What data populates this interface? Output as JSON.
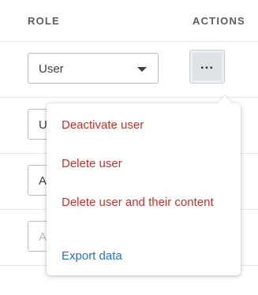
{
  "table": {
    "headers": {
      "role": "ROLE",
      "actions": "ACTIONS"
    },
    "rows": [
      {
        "role": "User",
        "actions_label": "..."
      },
      {
        "role": "U",
        "actions_label": ""
      },
      {
        "role": "A",
        "actions_label": ""
      },
      {
        "role": "A",
        "actions_label": ""
      }
    ]
  },
  "menu": {
    "items": [
      {
        "label": "Deactivate user",
        "kind": "danger"
      },
      {
        "label": "Delete user",
        "kind": "danger"
      },
      {
        "label": "Delete user and their content",
        "kind": "danger"
      },
      {
        "label": "Export data",
        "kind": "info"
      }
    ]
  },
  "colors": {
    "danger": "#c8302d",
    "info": "#2870c4",
    "header_text": "#5a5e62",
    "border": "#b8bdc2"
  }
}
